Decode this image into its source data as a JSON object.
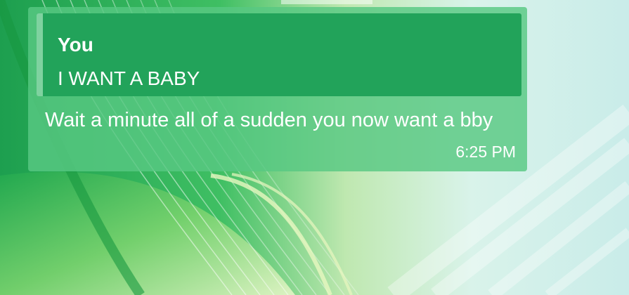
{
  "message": {
    "quoted": {
      "author": "You",
      "text": "I WANT A BABY"
    },
    "text": "Wait a minute all of a sudden you now want a bby",
    "time": "6:25 PM"
  },
  "colors": {
    "bubble": "#58c882",
    "quote_background": "#22a35a",
    "quote_bar": "#7fd2a0",
    "text": "#ffffff",
    "wallpaper_green": "#1ea850",
    "wallpaper_light": "#cfeee6"
  }
}
